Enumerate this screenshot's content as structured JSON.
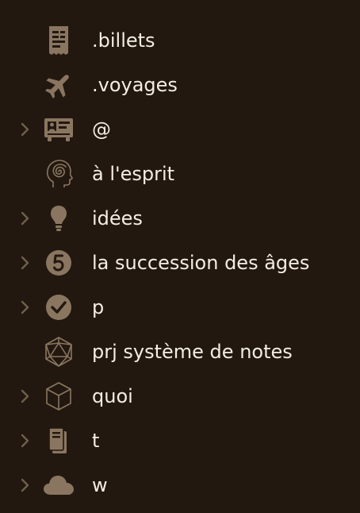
{
  "colors": {
    "background": "#221810",
    "icon": "#8a7660",
    "chevron": "#6f5f4c",
    "text": "#f4ede2"
  },
  "items": [
    {
      "label": ".billets",
      "icon": "receipt-icon",
      "expandable": false
    },
    {
      "label": ".voyages",
      "icon": "airplane-icon",
      "expandable": false
    },
    {
      "label": "@",
      "icon": "id-card-icon",
      "expandable": true
    },
    {
      "label": "à l'esprit",
      "icon": "head-spiral-icon",
      "expandable": false
    },
    {
      "label": "idées",
      "icon": "lightbulb-icon",
      "expandable": true
    },
    {
      "label": "la succession des âges",
      "icon": "number-5-circle-icon",
      "expandable": true
    },
    {
      "label": "p",
      "icon": "check-circle-icon",
      "expandable": true
    },
    {
      "label": "prj système de notes",
      "icon": "icosahedron-icon",
      "expandable": false
    },
    {
      "label": "quoi",
      "icon": "cube-icon",
      "expandable": true
    },
    {
      "label": "t",
      "icon": "book-icon",
      "expandable": true
    },
    {
      "label": "w",
      "icon": "cloud-icon",
      "expandable": true
    }
  ]
}
